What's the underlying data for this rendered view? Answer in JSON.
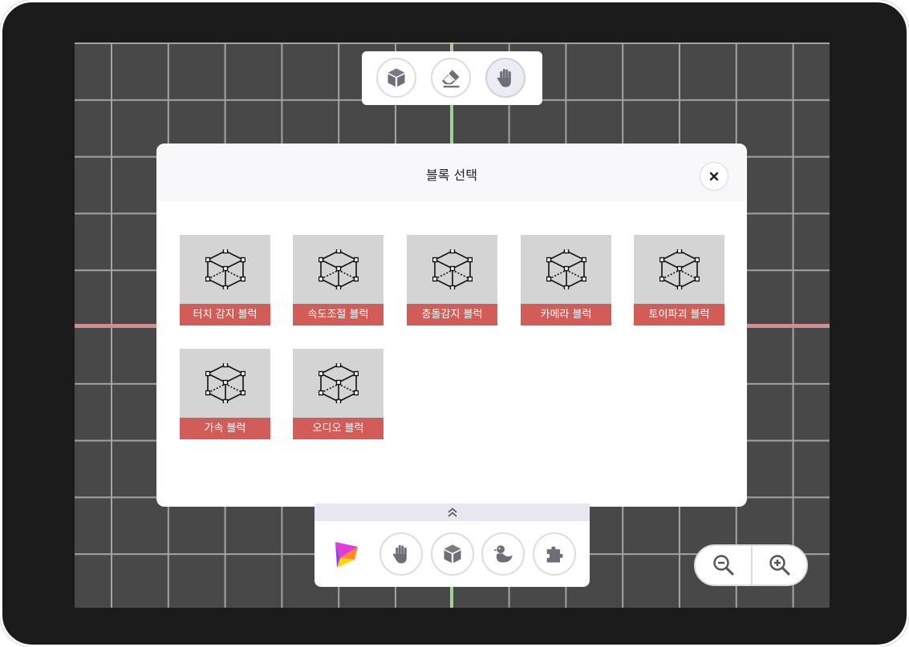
{
  "dialog": {
    "title": "블록 선택",
    "close_icon": "close-icon",
    "blocks": [
      {
        "label": "터치 감지 블럭",
        "icon": "cube-wireframe-icon"
      },
      {
        "label": "속도조절 블럭",
        "icon": "cube-wireframe-icon"
      },
      {
        "label": "충돌감지 블럭",
        "icon": "cube-wireframe-icon"
      },
      {
        "label": "카메라 블럭",
        "icon": "cube-wireframe-icon"
      },
      {
        "label": "토이파괴 블럭",
        "icon": "cube-wireframe-icon"
      },
      {
        "label": "가속 블럭",
        "icon": "cube-wireframe-icon"
      },
      {
        "label": "오디오 블럭",
        "icon": "cube-wireframe-icon"
      }
    ]
  },
  "top_toolbar": {
    "tools": [
      "cube-icon",
      "eraser-icon",
      "hand-icon"
    ],
    "active_tool": "hand-icon"
  },
  "bottom_toolbar": {
    "expand_icon": "chevron-double-up-icon",
    "logo": "app-logo",
    "tools": [
      "hand-icon",
      "cube-icon",
      "duck-icon",
      "puzzle-icon"
    ]
  },
  "zoom": {
    "controls": [
      "zoom-out-icon",
      "zoom-in-icon"
    ]
  },
  "colors": {
    "block_label_bg": "#d15c58",
    "block_tile_bg": "#d4d4d4",
    "canvas_bg": "#484848",
    "grid_line": "#a3a3a3",
    "axis_x": "#d98b8b",
    "axis_y": "#a6cf9a",
    "icon_gray": "#6e6e78"
  }
}
